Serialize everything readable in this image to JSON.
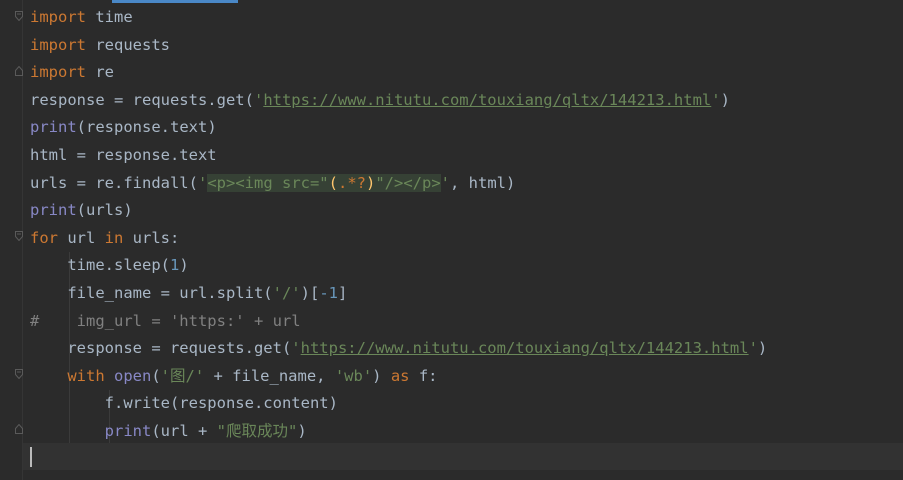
{
  "editor": {
    "language": "python",
    "colors": {
      "background": "#2b2b2b",
      "keyword": "#cc7832",
      "builtin": "#8888c6",
      "string": "#6a8759",
      "number": "#6897bb",
      "comment": "#808080",
      "text": "#a9b7c6"
    },
    "lines": [
      {
        "tokens": [
          {
            "t": "import",
            "c": "kw"
          },
          {
            "t": " time"
          }
        ]
      },
      {
        "tokens": [
          {
            "t": "import",
            "c": "kw"
          },
          {
            "t": " requests"
          }
        ]
      },
      {
        "tokens": [
          {
            "t": "import",
            "c": "kw"
          },
          {
            "t": " re"
          }
        ]
      },
      {
        "tokens": [
          {
            "t": "response = requests.get("
          },
          {
            "t": "'",
            "c": "str"
          },
          {
            "t": "https://www.nitutu.com/touxiang/qltx/144213.html",
            "c": "link"
          },
          {
            "t": "'",
            "c": "str"
          },
          {
            "t": ")"
          }
        ]
      },
      {
        "tokens": [
          {
            "t": "print",
            "c": "bi"
          },
          {
            "t": "(response.text)"
          }
        ]
      },
      {
        "tokens": [
          {
            "t": "html = response.text"
          }
        ]
      },
      {
        "tokens": [
          {
            "t": "urls = re.findall("
          },
          {
            "t": "'",
            "c": "str"
          },
          {
            "t": "<p><img src=\"",
            "c": "re-txt"
          },
          {
            "t": "(",
            "c": "re-grp"
          },
          {
            "t": ".*?",
            "c": "re-meta"
          },
          {
            "t": ")",
            "c": "re-grp"
          },
          {
            "t": "\"/></p>",
            "c": "re-txt"
          },
          {
            "t": "'",
            "c": "str"
          },
          {
            "t": ", html)"
          }
        ]
      },
      {
        "tokens": [
          {
            "t": "print",
            "c": "bi"
          },
          {
            "t": "(urls)"
          }
        ]
      },
      {
        "tokens": [
          {
            "t": "for",
            "c": "kw"
          },
          {
            "t": " url "
          },
          {
            "t": "in",
            "c": "kw"
          },
          {
            "t": " urls:"
          }
        ]
      },
      {
        "tokens": [
          {
            "t": "    time.sleep("
          },
          {
            "t": "1",
            "c": "num"
          },
          {
            "t": ")"
          }
        ]
      },
      {
        "tokens": [
          {
            "t": "    file_name = url.split("
          },
          {
            "t": "'/'",
            "c": "str"
          },
          {
            "t": ")["
          },
          {
            "t": "-1",
            "c": "num"
          },
          {
            "t": "]"
          }
        ]
      },
      {
        "tokens": [
          {
            "t": "#    img_url = 'https:' + url",
            "c": "cm"
          }
        ]
      },
      {
        "tokens": [
          {
            "t": "    response = requests.get("
          },
          {
            "t": "'",
            "c": "str"
          },
          {
            "t": "https://www.nitutu.com/touxiang/qltx/144213.html",
            "c": "link"
          },
          {
            "t": "'",
            "c": "str"
          },
          {
            "t": ")"
          }
        ]
      },
      {
        "tokens": [
          {
            "t": "    "
          },
          {
            "t": "with",
            "c": "kw"
          },
          {
            "t": " "
          },
          {
            "t": "open",
            "c": "bi"
          },
          {
            "t": "("
          },
          {
            "t": "'图/'",
            "c": "str"
          },
          {
            "t": " + file_name, "
          },
          {
            "t": "'wb'",
            "c": "str"
          },
          {
            "t": ") "
          },
          {
            "t": "as",
            "c": "kw"
          },
          {
            "t": " f:"
          }
        ]
      },
      {
        "tokens": [
          {
            "t": "        f.write(response.content)"
          }
        ]
      },
      {
        "tokens": [
          {
            "t": "        "
          },
          {
            "t": "print",
            "c": "bi"
          },
          {
            "t": "(url + "
          },
          {
            "t": "\"爬取成功\"",
            "c": "str"
          },
          {
            "t": ")"
          }
        ]
      },
      {
        "tokens": [
          {
            "t": ""
          }
        ]
      }
    ]
  }
}
